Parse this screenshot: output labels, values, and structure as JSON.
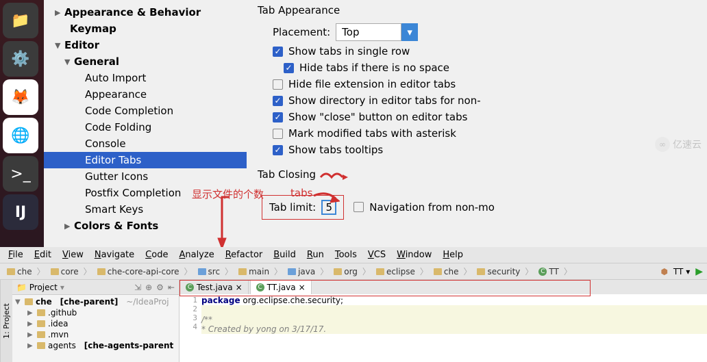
{
  "settings_tree": {
    "appearance_behavior": "Appearance & Behavior",
    "keymap": "Keymap",
    "editor": "Editor",
    "general": "General",
    "items": [
      "Auto Import",
      "Appearance",
      "Code Completion",
      "Code Folding",
      "Console",
      "Editor Tabs",
      "Gutter Icons",
      "Postfix Completion",
      "Smart Keys"
    ],
    "colors_fonts": "Colors & Fonts"
  },
  "tab_appearance": {
    "title": "Tab Appearance",
    "placement_label": "Placement:",
    "placement_value": "Top",
    "show_single_row": "Show tabs in single row",
    "hide_no_space": "Hide tabs if there is no space",
    "hide_ext": "Hide file extension in editor tabs",
    "show_dir": "Show directory in editor tabs for non-",
    "show_close": "Show \"close\" button on editor tabs",
    "mark_asterisk": "Mark modified tabs with asterisk",
    "show_tooltips": "Show tabs tooltips"
  },
  "tab_closing": {
    "title_prefix": "Tab Closing ",
    "tab_limit_label": "Tab limit:",
    "tab_limit_value": "5",
    "nav_label": "Navigation from non-mo"
  },
  "annotations": {
    "line1": "显示文件的个数",
    "line2": "tabs"
  },
  "menubar": [
    "File",
    "Edit",
    "View",
    "Navigate",
    "Code",
    "Analyze",
    "Refactor",
    "Build",
    "Run",
    "Tools",
    "VCS",
    "Window",
    "Help"
  ],
  "breadcrumb": [
    "che",
    "core",
    "che-core-api-core",
    "src",
    "main",
    "java",
    "org",
    "eclipse",
    "che",
    "security",
    "TT"
  ],
  "bc_selector": "TT",
  "project": {
    "panel_title": "Project",
    "root": "che",
    "root_suffix": "[che-parent]",
    "root_path": "~/IdeaProj",
    "nodes": [
      ".github",
      ".idea",
      ".mvn"
    ],
    "agents": "agents",
    "agents_suffix": "[che-agents-parent"
  },
  "editor_tabs": [
    {
      "name": "Test.java",
      "active": false
    },
    {
      "name": "TT.java",
      "active": true
    }
  ],
  "code": {
    "l1": "package",
    "l1b": " org.eclipse.che.security;",
    "l3": "/**",
    "l4": " * Created by yong on 3/17/17."
  },
  "side_tab": "1: Project",
  "watermark": "亿速云"
}
